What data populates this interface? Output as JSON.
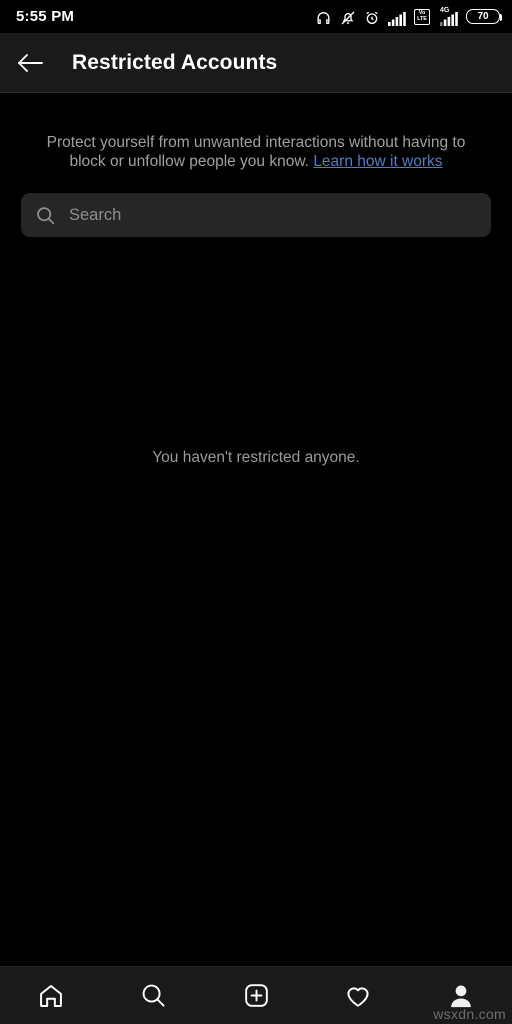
{
  "statusbar": {
    "time": "5:55 PM",
    "icons": [
      {
        "name": "headphones-icon"
      },
      {
        "name": "bell-muted-icon"
      },
      {
        "name": "alarm-clock-icon"
      },
      {
        "name": "signal-bars-icon"
      },
      {
        "name": "volte-icon"
      },
      {
        "name": "network-4g-signal-icon"
      },
      {
        "name": "battery-icon"
      }
    ],
    "volte_top": "Vo",
    "volte_bottom": "LTE",
    "network_type": "4G",
    "battery_level": "70"
  },
  "header": {
    "back_icon": "arrow-left-icon",
    "title": "Restricted Accounts"
  },
  "description": {
    "text": "Protect yourself from unwanted interactions without having to block or unfollow people you know. ",
    "link_label": "Learn how it works",
    "link_color": "#4a7fc4"
  },
  "search": {
    "icon": "search-icon",
    "placeholder": "Search",
    "value": ""
  },
  "empty_state": {
    "message": "You haven't restricted anyone."
  },
  "bottom_nav": {
    "items": [
      {
        "name": "nav-home",
        "icon": "home-icon",
        "active": false
      },
      {
        "name": "nav-search",
        "icon": "search-icon",
        "active": false
      },
      {
        "name": "nav-create",
        "icon": "plus-square-icon",
        "active": false
      },
      {
        "name": "nav-activity",
        "icon": "heart-icon",
        "active": false
      },
      {
        "name": "nav-profile",
        "icon": "person-icon",
        "active": true
      }
    ]
  },
  "watermark": {
    "text": "wsxdn.com"
  },
  "colors": {
    "background": "#000000",
    "surface": "#1a1a1a",
    "search_field": "#262626",
    "text_primary": "#ffffff",
    "text_secondary": "#a0a0a0",
    "link": "#4a7fc4"
  }
}
